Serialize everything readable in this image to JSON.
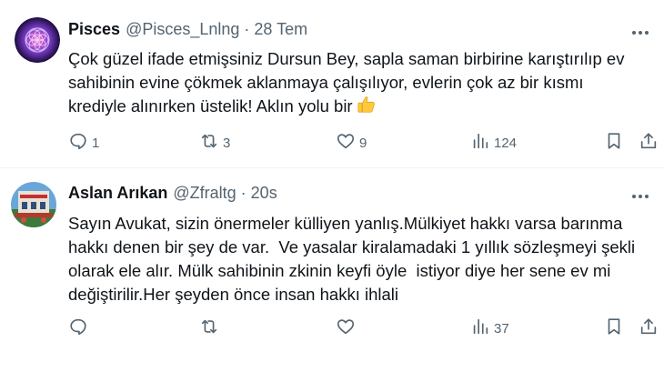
{
  "tweets": [
    {
      "name": "Pisces",
      "handle": "@Pisces_Lnlng",
      "dot": "·",
      "time": "28 Tem",
      "lines": [
        "Çok güzel ifade etmişsiniz Dursun Bey, sapla saman birbirine karıştırılıp ev",
        "sahibinin evine çökmek aklanmaya çalışılıyor, evlerin çok az bir kısmı",
        "krediyle alınırken üstelik! Aklın yolu bir"
      ],
      "emoji": "thumbs-up-icon",
      "replies": "1",
      "retweets": "3",
      "likes": "9",
      "views": "124",
      "avatar": "flower-of-life-avatar"
    },
    {
      "name": "Aslan Arıkan",
      "handle": "@Zfraltg",
      "dot": "·",
      "time": "20s",
      "lines": [
        "Sayın Avukat, sizin önermeler külliyen yanlış.Mülkiyet hakkı varsa barınma",
        "hakkı denen bir şey de var.  Ve yasalar kiralamadaki 1 yıllık sözleşmeyi şekli",
        "olarak ele alır. Mülk sahibinin zkinin keyfi öyle  istiyor diye her sene ev mi",
        "değiştirilir.Her şeyden önce insan hakkı ihlali"
      ],
      "replies": "",
      "retweets": "",
      "likes": "",
      "views": "37",
      "avatar": "building-photo-avatar"
    }
  ],
  "colors": {
    "text": "#0f1419",
    "secondary": "#536471",
    "divider": "#eff3f4",
    "emoji": "#ffc83d"
  }
}
